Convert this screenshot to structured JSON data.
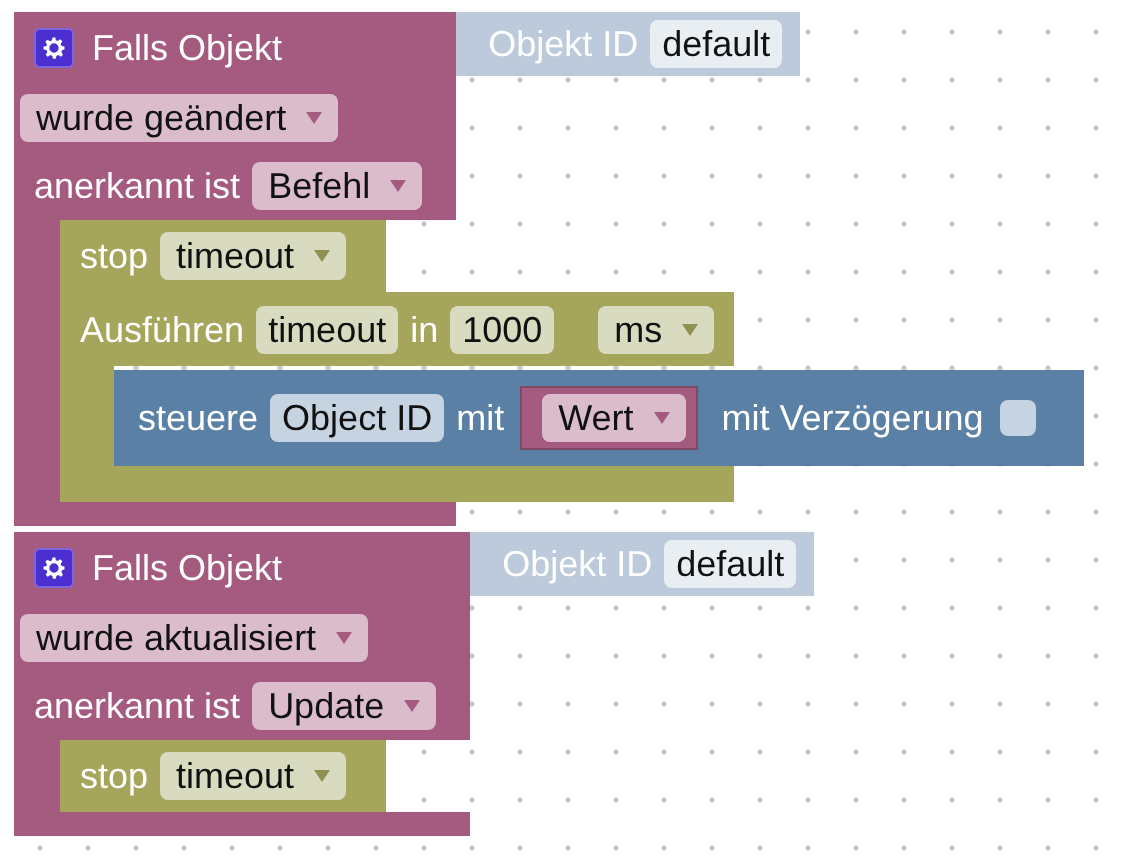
{
  "blocks": [
    {
      "title": "Falls Objekt",
      "object_input": {
        "label": "Objekt ID",
        "value": "default"
      },
      "event": "wurde geändert",
      "ack_label": "anerkannt ist",
      "ack": "Befehl",
      "statements": [
        {
          "kind": "stop",
          "label": "stop",
          "timer": "timeout"
        },
        {
          "kind": "timeout",
          "label": "Ausführen",
          "name": "timeout",
          "in_label": "in",
          "delay": "1000",
          "unit": "ms",
          "statements": [
            {
              "kind": "control",
              "label": "steuere",
              "object": "Object ID",
              "with_label": "mit",
              "value": "Wert",
              "delay_label": "mit Verzögerung",
              "delay_checked": false
            }
          ]
        }
      ]
    },
    {
      "title": "Falls Objekt",
      "object_input": {
        "label": "Objekt ID",
        "value": "default"
      },
      "event": "wurde aktualisiert",
      "ack_label": "anerkannt ist",
      "ack": "Update",
      "statements": [
        {
          "kind": "stop",
          "label": "stop",
          "timer": "timeout"
        }
      ]
    }
  ]
}
